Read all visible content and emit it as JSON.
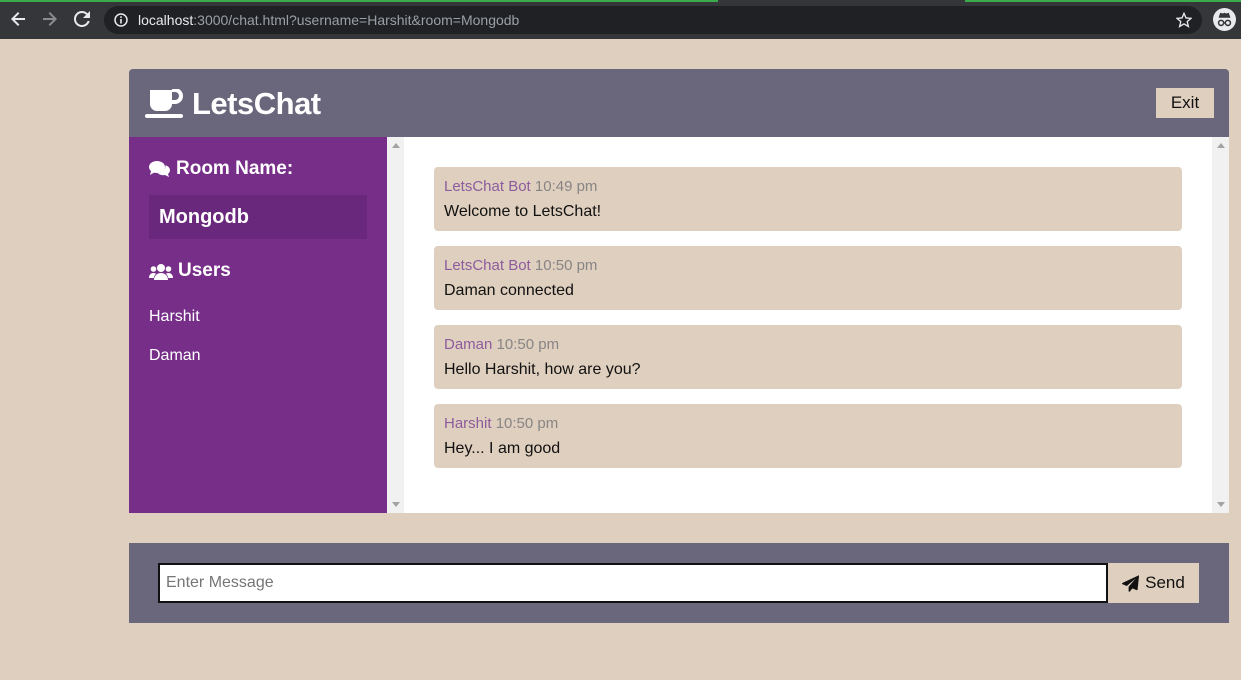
{
  "browser": {
    "url_host": "localhost",
    "url_rest": ":3000/chat.html?username=Harshit&room=Mongodb"
  },
  "header": {
    "app_title": "LetsChat",
    "exit_label": "Exit"
  },
  "sidebar": {
    "room_heading": "Room Name:",
    "room_name": "Mongodb",
    "users_heading": "Users",
    "users": [
      "Harshit",
      "Daman"
    ]
  },
  "messages": [
    {
      "author": "LetsChat Bot",
      "time": "10:49 pm",
      "text": "Welcome to LetsChat!"
    },
    {
      "author": "LetsChat Bot",
      "time": "10:50 pm",
      "text": "Daman connected"
    },
    {
      "author": "Daman",
      "time": "10:50 pm",
      "text": "Hello Harshit, how are you?"
    },
    {
      "author": "Harshit",
      "time": "10:50 pm",
      "text": "Hey... I am good"
    }
  ],
  "form": {
    "placeholder": "Enter Message",
    "value": "",
    "send_label": "Send"
  },
  "colors": {
    "background": "#dfcfbe",
    "header": "#6a677c",
    "sidebar": "#772e89",
    "author": "#8d5c9e"
  }
}
